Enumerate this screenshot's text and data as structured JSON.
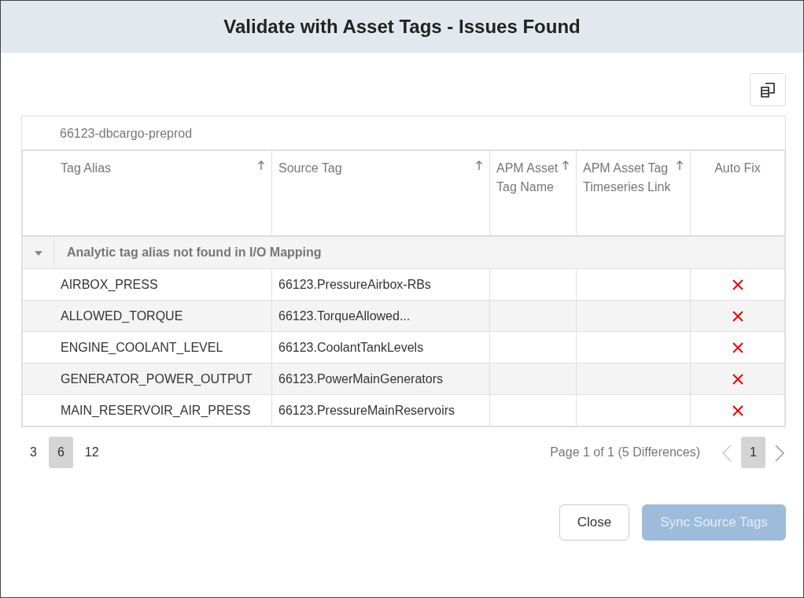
{
  "dialog": {
    "title": "Validate with Asset Tags - Issues Found"
  },
  "table": {
    "caption": "66123-dbcargo-preprod",
    "columns": [
      {
        "label": "Tag Alias",
        "sortable": true
      },
      {
        "label": "Source Tag",
        "sortable": true
      },
      {
        "label": "APM Asset Tag Name",
        "sortable": true
      },
      {
        "label": "APM Asset Tag Timeseries Link",
        "sortable": true
      },
      {
        "label": "Auto Fix",
        "sortable": false
      }
    ],
    "groups": [
      {
        "label": "Analytic tag alias not found in I/O Mapping",
        "expanded": true,
        "rows": [
          {
            "tag_alias": "AIRBOX_PRESS",
            "source_tag": "66123.PressureAirbox-RBs",
            "auto_fix": false
          },
          {
            "tag_alias": "ALLOWED_TORQUE",
            "source_tag": "66123.TorqueAllowed...",
            "auto_fix": false
          },
          {
            "tag_alias": "ENGINE_COOLANT_LEVEL",
            "source_tag": "66123.CoolantTankLevels",
            "auto_fix": false
          },
          {
            "tag_alias": "GENERATOR_POWER_OUTPUT",
            "source_tag": "66123.PowerMainGenerators",
            "auto_fix": false
          },
          {
            "tag_alias": "MAIN_RESERVOIR_AIR_PRESS",
            "source_tag": "66123.PressureMainReservoirs",
            "auto_fix": false
          }
        ]
      }
    ]
  },
  "page_sizes": [
    {
      "label": "3",
      "selected": false
    },
    {
      "label": "6",
      "selected": true
    },
    {
      "label": "12",
      "selected": false
    }
  ],
  "pager": {
    "summary": "Page 1 of 1 (5 Differences)",
    "prev_disabled": true,
    "next_disabled": false,
    "pages": [
      {
        "label": "1",
        "selected": true
      }
    ]
  },
  "buttons": [
    {
      "label": "Close",
      "kind": "secondary",
      "disabled": false
    },
    {
      "label": "Sync Source Tags",
      "kind": "primary",
      "disabled": true
    }
  ]
}
